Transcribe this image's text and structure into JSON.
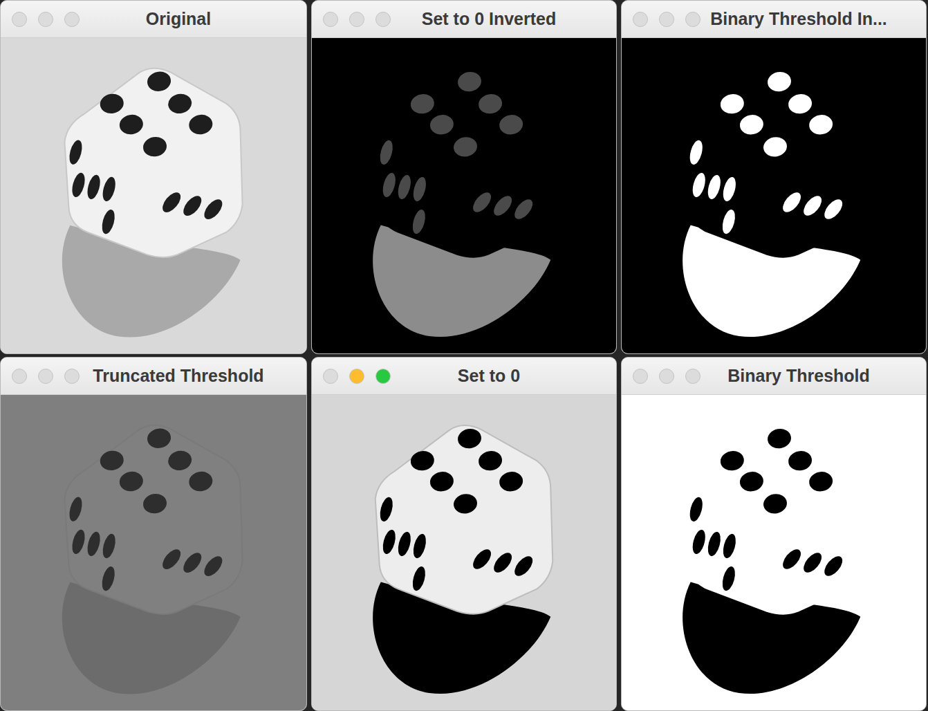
{
  "windows": [
    {
      "title": "Original",
      "focused": false,
      "kind": "original"
    },
    {
      "title": "Set to 0 Inverted",
      "focused": false,
      "kind": "tozero_inv"
    },
    {
      "title": "Binary Threshold In...",
      "focused": false,
      "kind": "binary_inv"
    },
    {
      "title": "Truncated Threshold",
      "focused": false,
      "kind": "trunc"
    },
    {
      "title": "Set to 0",
      "focused": true,
      "kind": "tozero"
    },
    {
      "title": "Binary Threshold",
      "focused": false,
      "kind": "binary"
    }
  ]
}
